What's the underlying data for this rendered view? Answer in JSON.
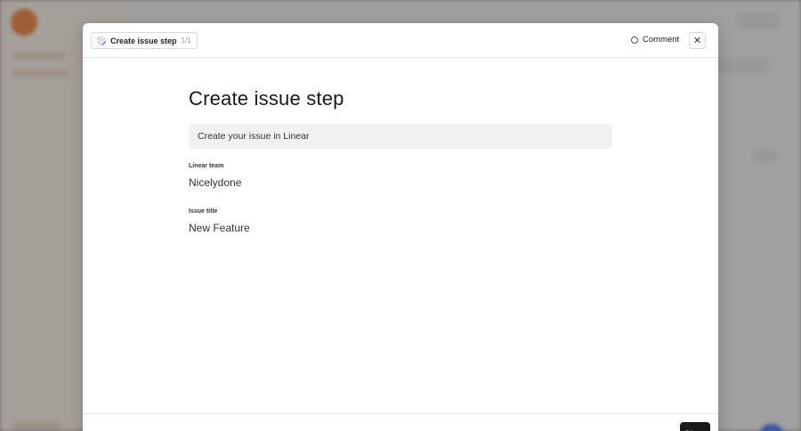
{
  "modal": {
    "step_pill": {
      "icon": "linear-icon",
      "label": "Create issue step",
      "count": "1/1"
    },
    "comment_label": "Comment",
    "comment_icon": "comment-icon",
    "close_icon": "close-icon",
    "title": "Create issue step",
    "description": "Create your issue in Linear",
    "fields": [
      {
        "label": "Linear team",
        "value": "Nicelydone"
      },
      {
        "label": "Issue title",
        "value": "New Feature"
      }
    ],
    "close_button": "Close"
  },
  "colors": {
    "accent_dark": "#1a1a1a",
    "background_logo": "#f07a32",
    "linear_brand": "#5e6ad2"
  }
}
